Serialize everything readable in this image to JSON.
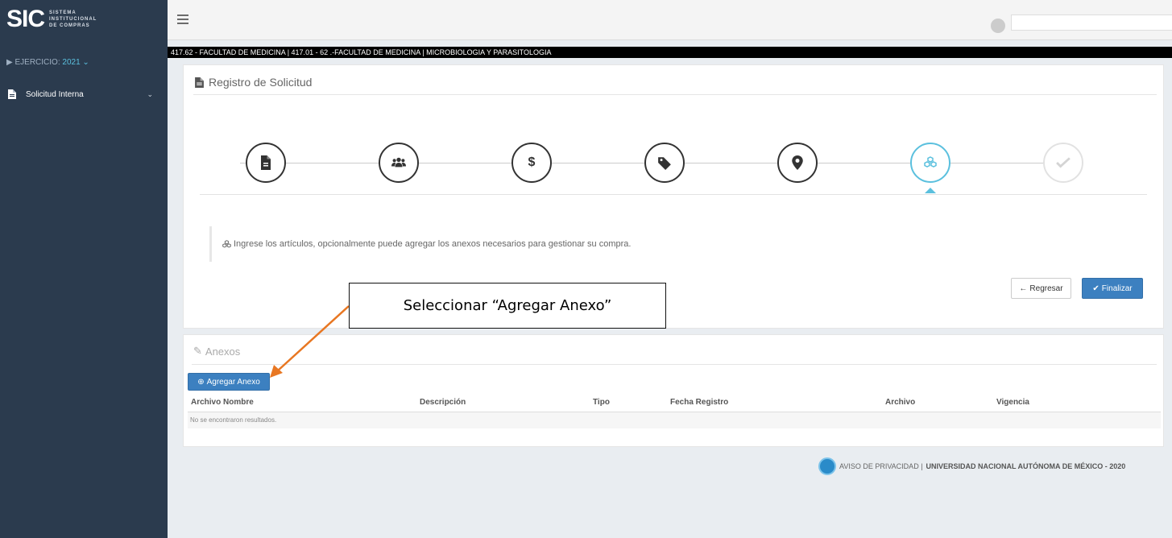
{
  "sidebar": {
    "logo_mark": "SIC",
    "logo_lines": [
      "SISTEMA",
      "INSTITUCIONAL",
      "DE COMPRAS"
    ],
    "ejercicio_label": "EJERCICIO:",
    "ejercicio_year": "2021",
    "items": [
      {
        "label": "Solicitud Interna",
        "icon": "document-icon"
      }
    ]
  },
  "path_bar": "417.62 - FACULTAD DE MEDICINA | 417.01 - 62 .-FACULTAD DE MEDICINA | MICROBIOLOGIA Y PARASITOLOGIA",
  "registro": {
    "title": "Registro de Solicitud",
    "steps": [
      {
        "icon": "document-icon",
        "state": "done"
      },
      {
        "icon": "users-icon",
        "state": "done"
      },
      {
        "icon": "dollar-icon",
        "state": "done"
      },
      {
        "icon": "tag-icon",
        "state": "done"
      },
      {
        "icon": "map-marker-icon",
        "state": "done"
      },
      {
        "icon": "cubes-icon",
        "state": "active"
      },
      {
        "icon": "check-icon",
        "state": "disabled"
      }
    ],
    "callout": "Ingrese los artículos, opcionalmente puede agregar los anexos necesarios para gestionar su compra.",
    "btn_regresar": "Regresar",
    "btn_finalizar": "Finalizar"
  },
  "anexos": {
    "title": "Anexos",
    "btn_agregar": "Agregar Anexo",
    "columns": [
      "Archivo Nombre",
      "Descripción",
      "Tipo",
      "Fecha Registro",
      "Archivo",
      "Vigencia"
    ],
    "empty": "No se encontraron resultados."
  },
  "footer": {
    "aviso": "AVISO DE PRIVACIDAD |",
    "unam": "UNIVERSIDAD NACIONAL AUTÓNOMA DE MÉXICO - 2020"
  },
  "annotation": {
    "text": "Seleccionar “Agregar Anexo”",
    "color": "#e87722"
  },
  "colors": {
    "sidebar": "#2b3b4e",
    "primary": "#3c80c0",
    "active_step": "#5bc0de"
  }
}
